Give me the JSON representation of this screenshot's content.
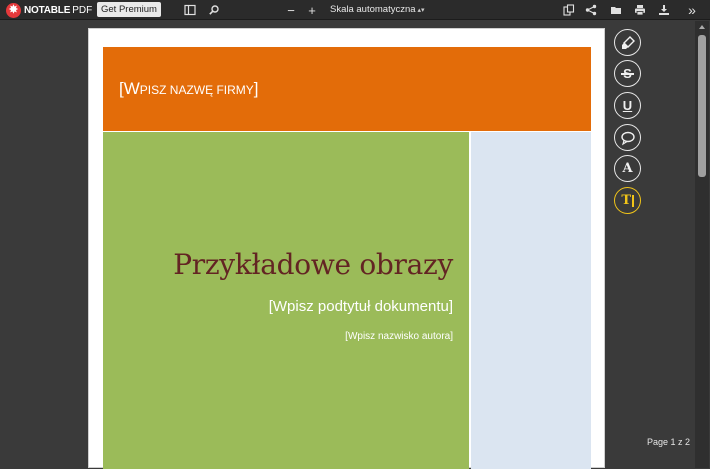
{
  "toolbar": {
    "logo_bold": "NOTABLE",
    "logo_light": "PDF",
    "premium_label": "Get Premium",
    "minus_label": "−",
    "plus_label": "+",
    "zoom_value": "Skala automatyczna",
    "more_label": "»",
    "icons": [
      "sidebar-toggle-icon",
      "search-icon",
      "zoom-out-icon",
      "zoom-in-icon",
      "copy-icon",
      "share-icon",
      "open-folder-icon",
      "print-icon",
      "download-icon",
      "more-tools-icon"
    ]
  },
  "document": {
    "company_first": "[W",
    "company_rest": "PISZ NAZWĘ FIRMY",
    "company_close": "]",
    "title": "Przykładowe obrazy",
    "subtitle": "[Wpisz podtytuł dokumentu]",
    "author": "[Wpisz nazwisko autora]",
    "colors": {
      "header": "#e36c09",
      "green": "#9bbb59",
      "blue": "#dbe5f1",
      "title": "#632423"
    }
  },
  "tools": [
    {
      "name": "highlight-tool",
      "icon": "highlighter-icon"
    },
    {
      "name": "strikethrough-tool",
      "icon": "strikethrough-icon",
      "glyph": "S"
    },
    {
      "name": "underline-tool",
      "icon": "underline-icon",
      "glyph": "U"
    },
    {
      "name": "comment-tool",
      "icon": "comment-bubble-icon"
    },
    {
      "name": "signature-tool",
      "icon": "pen-a-icon",
      "glyph": "A"
    },
    {
      "name": "text-tool",
      "icon": "text-cursor-icon",
      "glyph": "T",
      "active": true,
      "accent": "#f0c419"
    }
  ],
  "footer": {
    "page_indicator": "Page 1 z 2"
  }
}
